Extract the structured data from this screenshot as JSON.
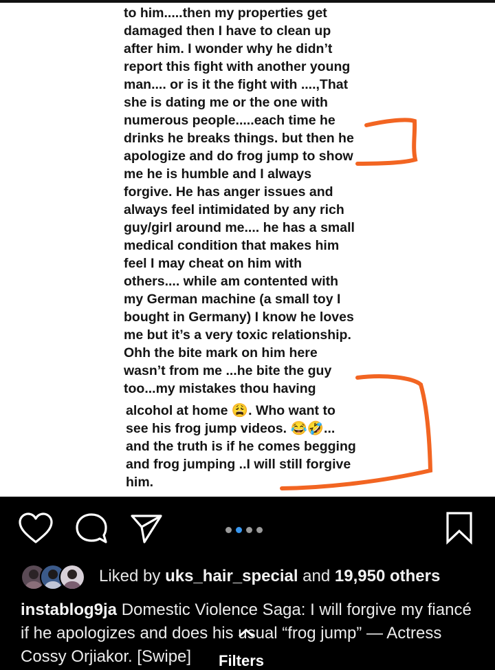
{
  "post": {
    "lines": [
      "to him.....then my properties get",
      "damaged then I have to clean up",
      "after him. I wonder why he didn’t",
      "report this fight with another young",
      "man.... or is it the fight with ....,That",
      "she is dating me or the one with",
      "numerous people.....each time he",
      "drinks he breaks things. but then he",
      "apologize and do frog jump to show",
      "me he is humble and I always",
      "forgive.  He has anger issues and",
      "always feel intimidated by any rich",
      "guy/girl around me.... he has a small",
      "medical condition that makes him",
      "feel I may cheat on him with",
      "others.... while am contented with",
      "my German machine (a small toy I",
      "bought in Germany)  I know he loves",
      "me but it’s a very toxic relationship.",
      "Ohh the bite mark on him here",
      "wasn’t from me ...he bite the guy",
      "too...my mistakes thou having"
    ],
    "lines2": [
      "alcohol at home 😩. Who want to",
      "see his frog jump videos. 😂🤣...",
      "and the truth is if he comes begging",
      "and frog jumping ..I  will still forgive",
      "him."
    ],
    "annotation_color": "#f26522"
  },
  "actions": {
    "like_icon": "heart-icon",
    "comment_icon": "comment-icon",
    "share_icon": "send-icon",
    "save_icon": "bookmark-icon",
    "carousel_total": 4,
    "carousel_active": 2
  },
  "likes": {
    "prefix": "Liked by ",
    "user": "uks_hair_special",
    "middle": " and ",
    "count": "19,950 others"
  },
  "caption": {
    "username": "instablog9ja",
    "text": " Domestic Violence Saga: I will forgive my fiancé if he apologizes and does his usual “frog jump” — Actress Cossy Orjiakor. [Swipe]"
  },
  "filters_label": "Filters",
  "colors": {
    "accent": "#3897f0",
    "background": "#000000",
    "text": "#ececec"
  }
}
